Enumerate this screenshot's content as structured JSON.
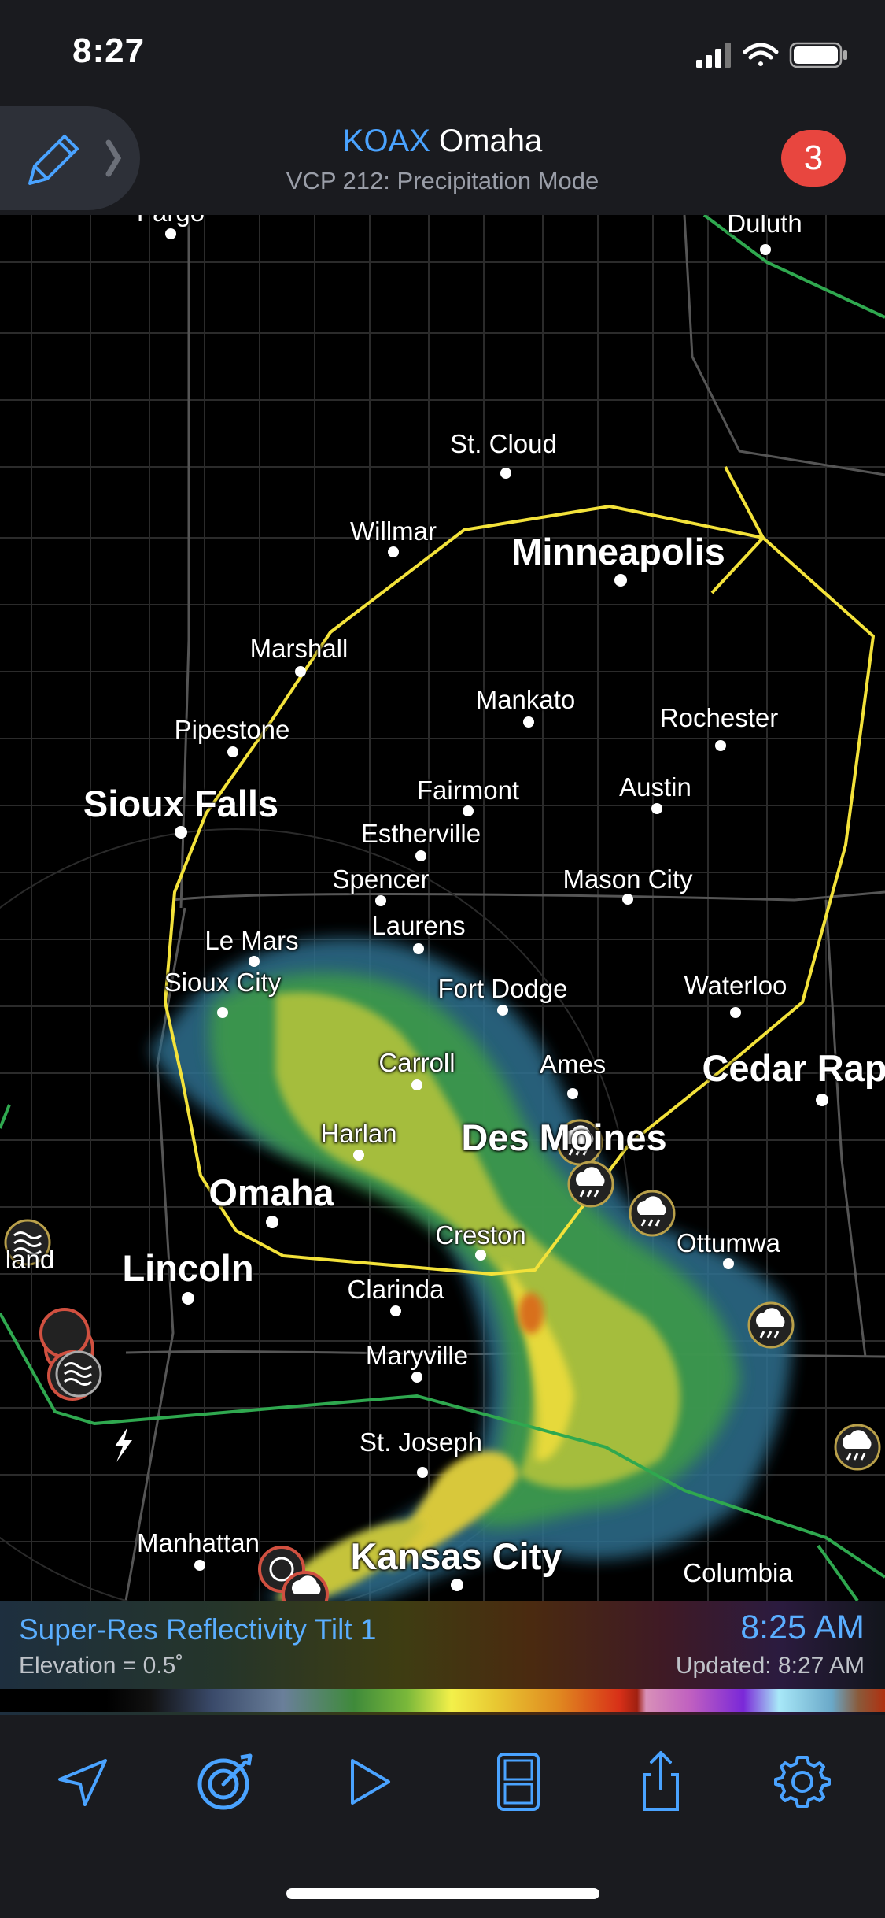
{
  "status_bar": {
    "time": "8:27"
  },
  "header": {
    "site": "KOAX",
    "city": "Omaha",
    "mode": "VCP 212: Precipitation Mode",
    "alerts_count": "3"
  },
  "map": {
    "cities": [
      {
        "name": "Fargo",
        "size": "sm"
      },
      {
        "name": "Duluth",
        "size": "sm"
      },
      {
        "name": "St. Cloud",
        "size": "sm"
      },
      {
        "name": "Willmar",
        "size": "sm"
      },
      {
        "name": "Minneapolis",
        "size": "lg"
      },
      {
        "name": "Marshall",
        "size": "sm"
      },
      {
        "name": "Mankato",
        "size": "sm"
      },
      {
        "name": "Rochester",
        "size": "sm"
      },
      {
        "name": "Pipestone",
        "size": "sm"
      },
      {
        "name": "Fairmont",
        "size": "sm"
      },
      {
        "name": "Austin",
        "size": "sm"
      },
      {
        "name": "Sioux Falls",
        "size": "lg"
      },
      {
        "name": "Estherville",
        "size": "sm"
      },
      {
        "name": "Spencer",
        "size": "sm"
      },
      {
        "name": "Mason City",
        "size": "sm"
      },
      {
        "name": "Laurens",
        "size": "sm"
      },
      {
        "name": "Le Mars",
        "size": "sm"
      },
      {
        "name": "Sioux City",
        "size": "sm"
      },
      {
        "name": "Fort Dodge",
        "size": "sm"
      },
      {
        "name": "Waterloo",
        "size": "sm"
      },
      {
        "name": "Carroll",
        "size": "sm"
      },
      {
        "name": "Ames",
        "size": "sm"
      },
      {
        "name": "Cedar Rap",
        "size": "lg"
      },
      {
        "name": "Harlan",
        "size": "sm"
      },
      {
        "name": "Des Moines",
        "size": "lg"
      },
      {
        "name": "Omaha",
        "size": "lg"
      },
      {
        "name": "Creston",
        "size": "sm"
      },
      {
        "name": "Ottumwa",
        "size": "sm"
      },
      {
        "name": "Lincoln",
        "size": "lg"
      },
      {
        "name": "Clarinda",
        "size": "sm"
      },
      {
        "name": "Maryville",
        "size": "sm"
      },
      {
        "name": "St. Joseph",
        "size": "sm"
      },
      {
        "name": "Manhattan",
        "size": "sm"
      },
      {
        "name": "Kansas City",
        "size": "lg"
      },
      {
        "name": "Columbia",
        "size": "sm"
      },
      {
        "name": "land",
        "size": "sm"
      }
    ]
  },
  "legend": {
    "product": "Super-Res Reflectivity Tilt 1",
    "elevation": "Elevation = 0.5˚",
    "scan_time": "8:25 AM",
    "updated": "Updated: 8:27 AM"
  },
  "toolbar": {
    "buttons": [
      "location-arrow-icon",
      "radar-icon",
      "play-icon",
      "layout-icon",
      "share-icon",
      "settings-icon"
    ]
  },
  "colors": {
    "accent": "#4aa3ff",
    "badge": "#e8463f",
    "warning_polygon": "#f3e23a",
    "boundary": "#2fa84f"
  }
}
